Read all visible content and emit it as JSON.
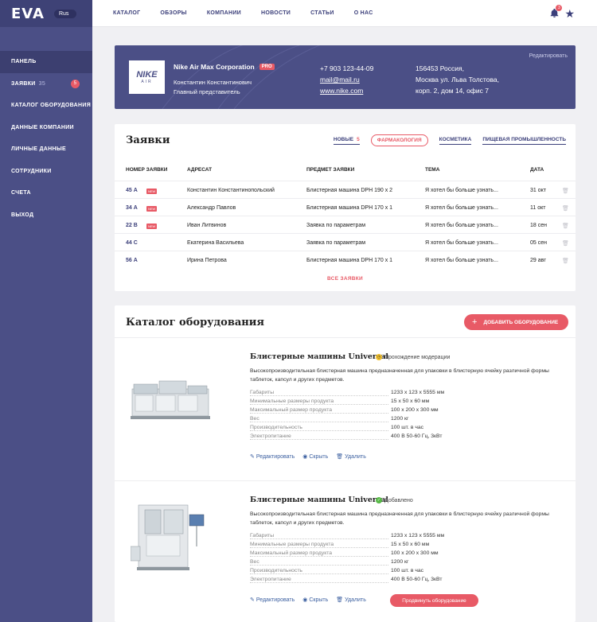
{
  "sidebar": {
    "logo": "EVA",
    "lang": "Rus",
    "items": [
      {
        "label": "Панель"
      },
      {
        "label": "Заявки",
        "count": "35",
        "badge": "5"
      },
      {
        "label": "Каталог оборудования"
      },
      {
        "label": "Данные компании"
      },
      {
        "label": "Личные данные"
      },
      {
        "label": "Сотрудники"
      },
      {
        "label": "Счета"
      },
      {
        "label": "Выход"
      }
    ]
  },
  "topnav": {
    "items": [
      "Каталог",
      "Обзоры",
      "Компании",
      "Новости",
      "Статьи",
      "О нас"
    ],
    "notifications": "3",
    "bell_icon": "bell-icon",
    "star_icon": "star-icon"
  },
  "company": {
    "edit": "Редактировать",
    "logo_text": "NIKE",
    "logo_sub": "AIR",
    "name": "Nike Air Max Corporation",
    "badge": "PRO",
    "person": "Константин Константинович",
    "position": "Главный представитель",
    "phone": "+7 903 123-44-09",
    "email": "mail@mail.ru",
    "site": "www.nike.com",
    "address1": "156453 Россия,",
    "address2": "Москва ул. Льва Толстова,",
    "address3": "корп. 2, дом 14, офис 7"
  },
  "orders": {
    "title": "Заявки",
    "tabs": [
      {
        "label": "Новые",
        "count": "5"
      },
      {
        "label": "Фармакология"
      },
      {
        "label": "Косметика"
      },
      {
        "label": "Пищевая промышленность"
      }
    ],
    "columns": [
      "Номер заявки",
      "Адресат",
      "Предмет заявки",
      "Тема",
      "Дата"
    ],
    "new_label": "NEW",
    "rows": [
      {
        "num": "45 А",
        "new": true,
        "to": "Константин Константинопольский",
        "subject": "Блистерная машина DPH 190 x 2",
        "topic": "Я хотел бы больше узнать...",
        "date": "31 окт"
      },
      {
        "num": "34 А",
        "new": true,
        "to": "Александр Павлов",
        "subject": "Блистерная машина DPH 170 x 1",
        "topic": "Я хотел бы больше узнать...",
        "date": "11 окт"
      },
      {
        "num": "22 В",
        "new": true,
        "to": "Иван Литвинов",
        "subject": "Заявка по параметрам",
        "topic": "Я хотел бы больше узнать...",
        "date": "18 сен"
      },
      {
        "num": "44 С",
        "new": false,
        "to": "Екатерина Васильева",
        "subject": "Заявка по параметрам",
        "topic": "Я хотел бы больше узнать...",
        "date": "05 сен"
      },
      {
        "num": "56 А",
        "new": false,
        "to": "Ирина Петрова",
        "subject": "Блистерная машина DPH 170 x 1",
        "topic": "Я хотел бы больше узнать...",
        "date": "29 авг"
      }
    ],
    "all": "Все заявки"
  },
  "catalog": {
    "title": "Каталог оборудования",
    "add": "Добавить оборудование",
    "spec_labels": [
      "Габариты",
      "Минимальные размеры продукта",
      "Максимальный размер продукта",
      "Вес",
      "Производительность",
      "Электропитание"
    ],
    "actions": {
      "edit": "Редактировать",
      "hide": "Скрыть",
      "delete": "Удалить"
    },
    "promote": "Продвинуть оборудование",
    "products": [
      {
        "name": "Блистерные машины Universal",
        "status": "Прохождение модерации",
        "status_color": "#f2c12e",
        "desc": "Высокопроизводительная блистерная машина предназначенная для упаковки в блистерную ячейку различной формы таблеток, капсул и других предметов.",
        "specs": [
          "1233 x 123 x 5555 мм",
          "15 x 50 x 60 мм",
          "100 x 200 x 300 мм",
          "1200 кг",
          "100 шт. в час",
          "400 В 50-60 Гц, 3кВт"
        ]
      },
      {
        "name": "Блистерные машины Universal",
        "status": "Добавлено",
        "status_color": "#58b947",
        "desc": "Высокопроизводительная блистерная машина предназначенная для упаковки в блистерную ячейку различной формы таблеток, капсул и других предметов.",
        "specs": [
          "1233 x 123 x 5555 мм",
          "15 x 50 x 60 мм",
          "100 x 200 x 300 мм",
          "1200 кг",
          "100 шт. в час",
          "400 В 50-60 Гц, 3кВт"
        ]
      }
    ]
  }
}
